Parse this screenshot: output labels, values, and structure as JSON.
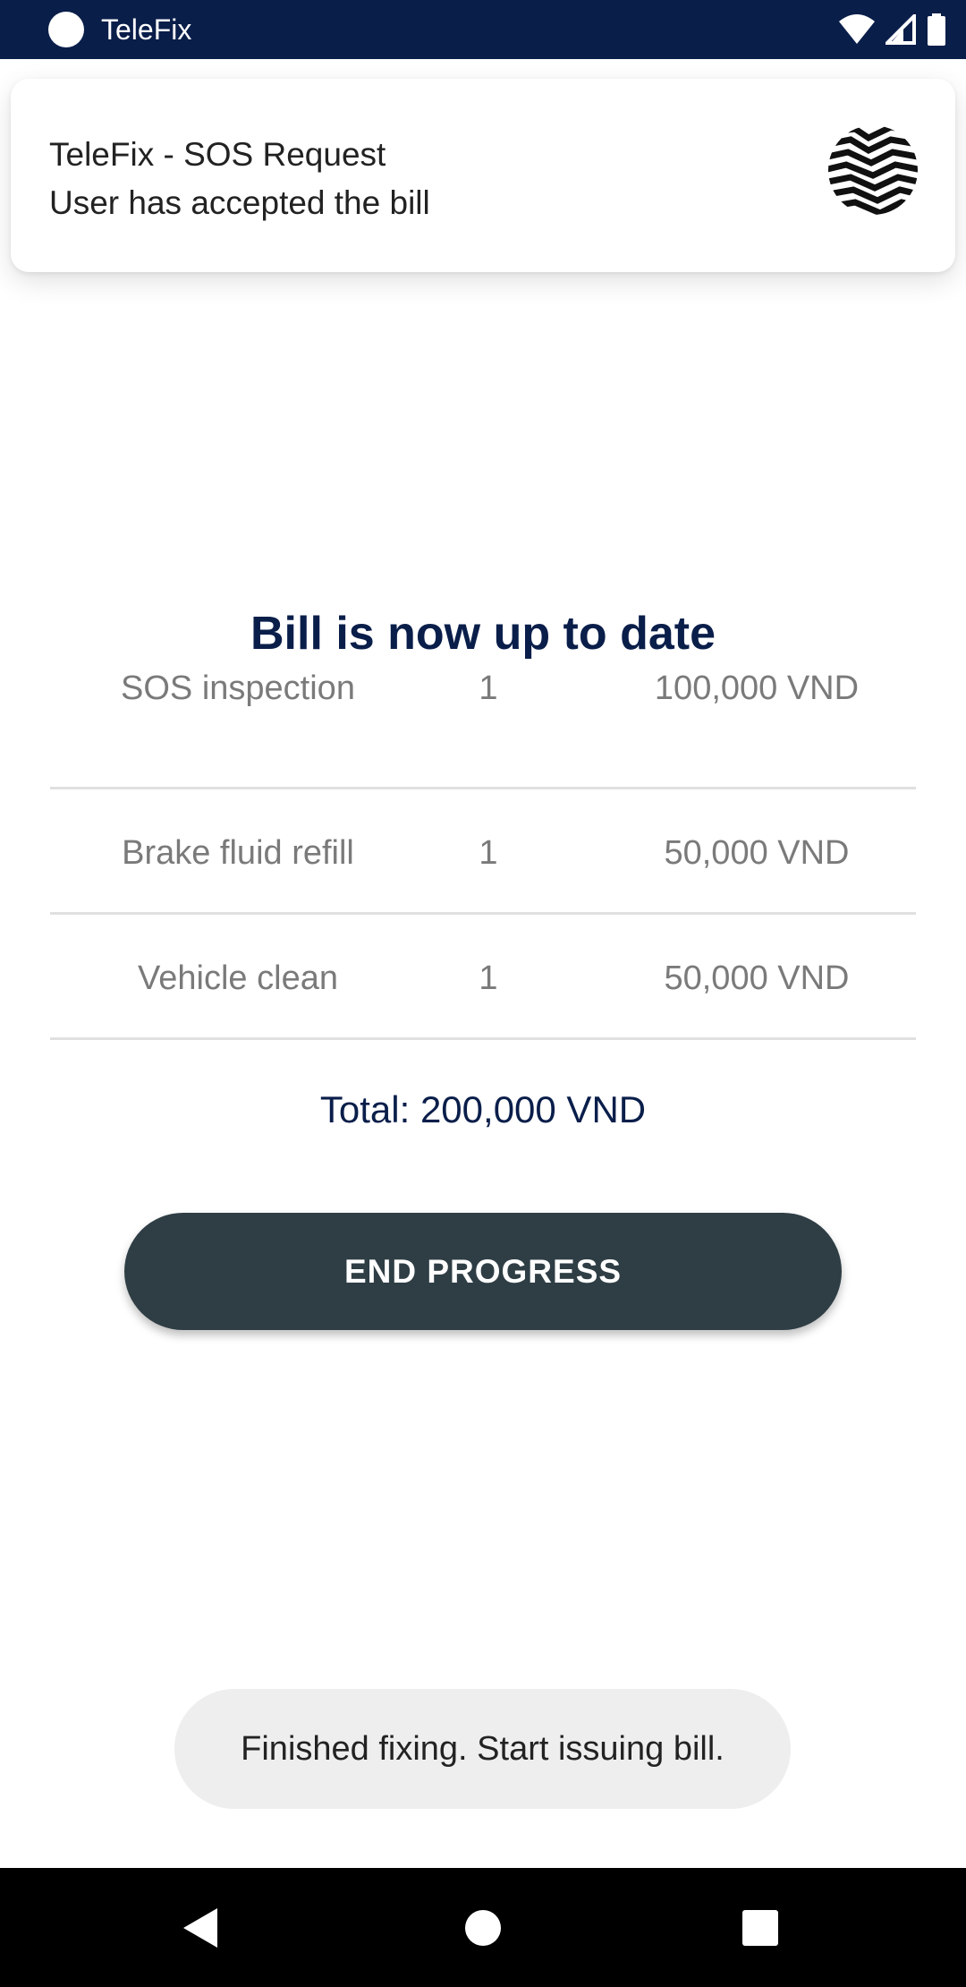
{
  "status_bar": {
    "app_name": "TeleFix",
    "icons": [
      "wifi-icon",
      "signal-icon",
      "battery-icon"
    ]
  },
  "notification": {
    "title": "TeleFix - SOS Request",
    "body": "User has accepted the bill",
    "logo_icon": "telefix-logo-icon"
  },
  "bill": {
    "heading": "Bill is now up to date",
    "items": [
      {
        "name": "SOS inspection",
        "qty": "1",
        "price": "100,000 VND"
      },
      {
        "name": "Brake fluid refill",
        "qty": "1",
        "price": "50,000 VND"
      },
      {
        "name": "Vehicle clean",
        "qty": "1",
        "price": "50,000 VND"
      }
    ],
    "total": "Total: 200,000 VND"
  },
  "actions": {
    "end_progress_label": "END PROGRESS"
  },
  "toast": {
    "message": "Finished fixing. Start issuing bill."
  },
  "colors": {
    "status_bar": "#0a1e4a",
    "heading": "#0a1e4a",
    "button": "#2f3e45",
    "muted_text": "#7a7a7a"
  },
  "nav_bar": {
    "icons": [
      "back-icon",
      "home-icon",
      "recents-icon"
    ]
  }
}
